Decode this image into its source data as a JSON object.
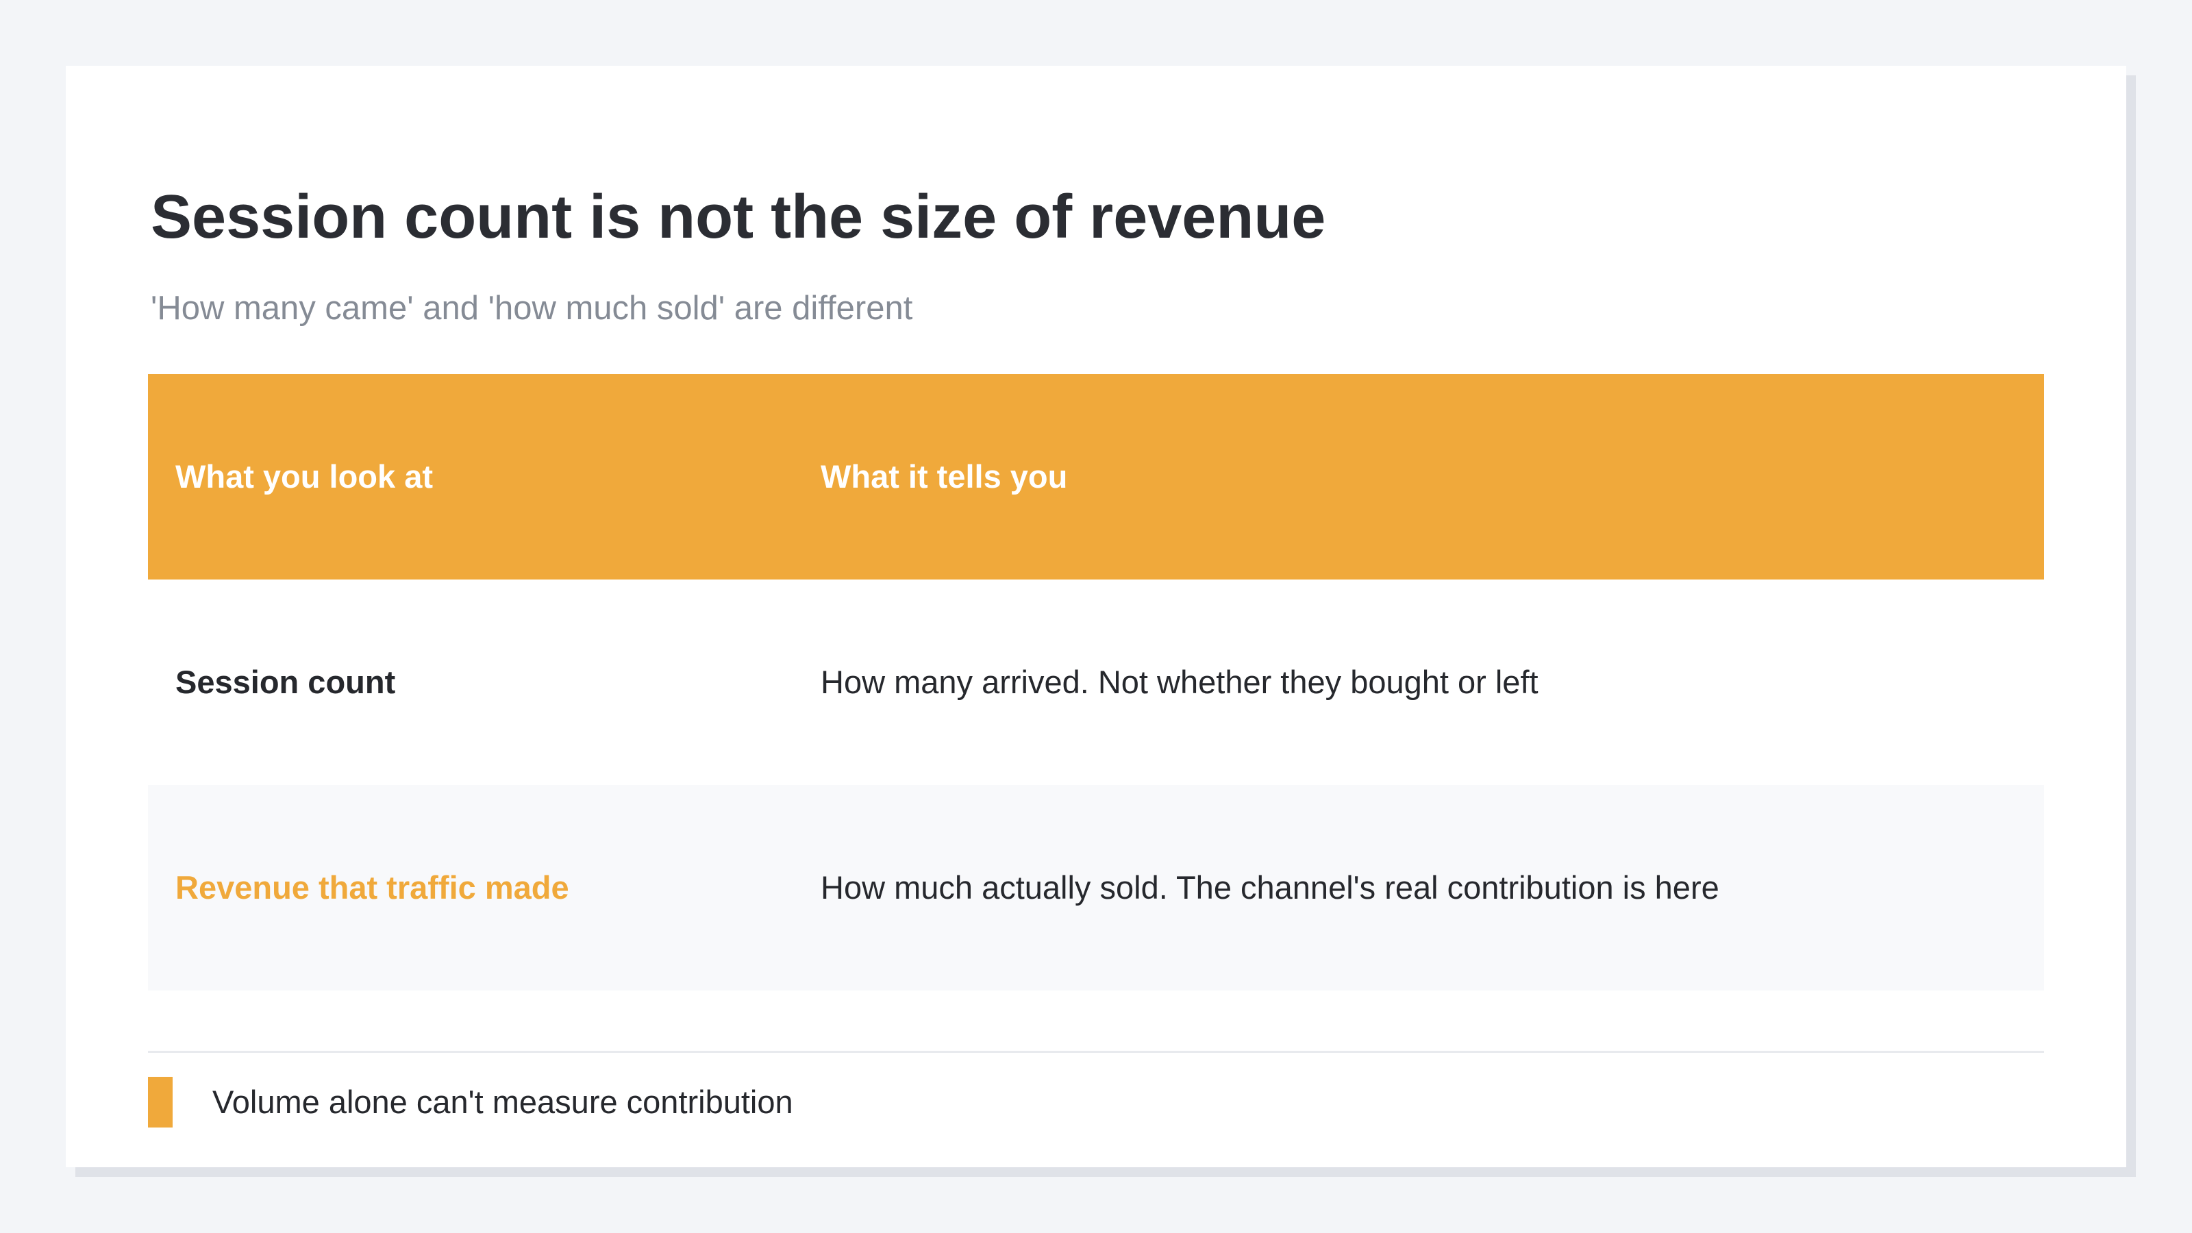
{
  "slide": {
    "title": "Session count is not the size of revenue",
    "subtitle": "'How many came' and 'how much sold' are different"
  },
  "table": {
    "headers": [
      "What you look at",
      "What it tells you"
    ],
    "rows": [
      {
        "label": "Session count",
        "description": "How many arrived. Not whether they bought or left"
      },
      {
        "label": "Revenue that traffic made",
        "description": "How much actually sold. The channel's real contribution is here"
      }
    ]
  },
  "note": {
    "text": "Volume alone can't measure contribution"
  },
  "colors": {
    "accent": "#f0a93b",
    "background": "#f3f5f8",
    "card": "#ffffff",
    "text": "#26282d",
    "muted": "#858b95"
  }
}
